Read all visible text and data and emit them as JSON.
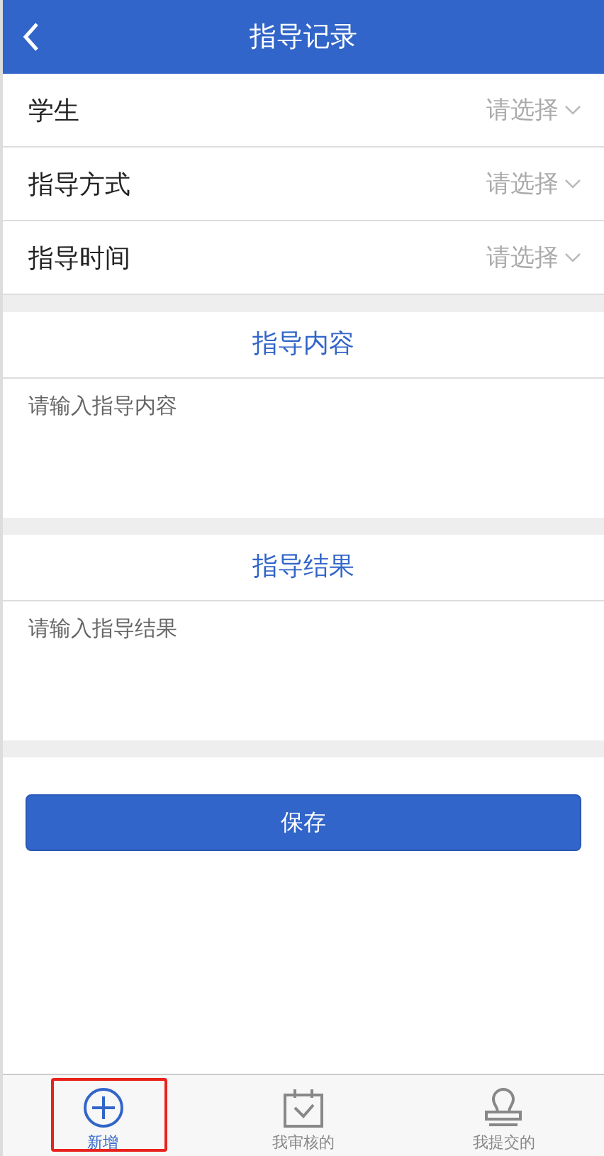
{
  "header": {
    "title": "指导记录"
  },
  "fields": [
    {
      "label": "学生",
      "placeholder": "请选择"
    },
    {
      "label": "指导方式",
      "placeholder": "请选择"
    },
    {
      "label": "指导时间",
      "placeholder": "请选择"
    }
  ],
  "sections": [
    {
      "title": "指导内容",
      "placeholder": "请输入指导内容"
    },
    {
      "title": "指导结果",
      "placeholder": "请输入指导结果"
    }
  ],
  "save_button": "保存",
  "tabs": [
    {
      "label": "新增",
      "kind": "plus",
      "selected": true,
      "annotated": true
    },
    {
      "label": "我审核的",
      "kind": "calendar",
      "selected": false,
      "annotated": false
    },
    {
      "label": "我提交的",
      "kind": "stamp",
      "selected": false,
      "annotated": false
    }
  ]
}
